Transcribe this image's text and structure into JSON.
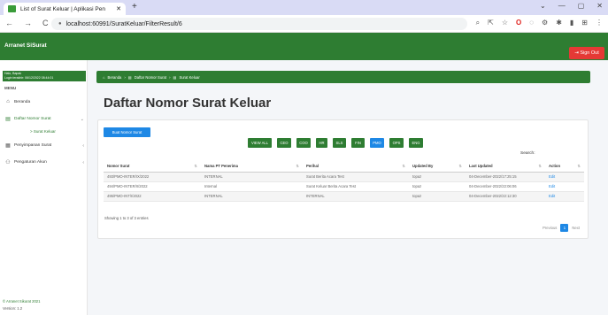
{
  "browser": {
    "tab_title": "List of Surat Keluar | Aplikasi Pen",
    "tab_close": "✕",
    "new_tab": "+",
    "url": "localhost:60991/SuratKeluar/FilterResult/6",
    "win_minimize": "⌄",
    "win_min": "—",
    "win_restore": "▢",
    "win_close": "✕"
  },
  "app": {
    "brand": "Arranet SiSurat",
    "sign_out": "Sign Out"
  },
  "sidebar": {
    "user_line1": "Halo, Bapak",
    "user_line2": "Login terakhir: 06/12/2022 08:44:01",
    "menu_label": "MENU",
    "items": [
      {
        "label": "Beranda",
        "icon": "home-icon"
      },
      {
        "label": "Daftar Nomor Surat",
        "icon": "document-icon"
      },
      {
        "label": "Penyimpanan Surat",
        "icon": "archive-icon"
      },
      {
        "label": "Pengaturan Akun",
        "icon": "users-icon"
      }
    ],
    "sub_item": "> Surat Keluar",
    "footer_copyright": "© Arranet Sikurat 2021",
    "footer_version": "Version: 1.2"
  },
  "breadcrumb": [
    "Beranda",
    "Daftar Nomor Surat",
    "Surat Keluar"
  ],
  "page_title": "Daftar Nomor Surat Keluar",
  "buttons": {
    "buat": "Buat Nomor Surat"
  },
  "filters": [
    "VIEW ALL",
    "CEO",
    "COO",
    "HR",
    "SLS",
    "FIN",
    "PMO",
    "OPS",
    "ENG"
  ],
  "active_filter": "PMO",
  "search_label": "Search:",
  "table": {
    "headers": [
      "Nomor Surat",
      "Nama PT Penerima",
      "Perihal",
      "Updated By",
      "Last Updated",
      "Action"
    ],
    "rows": [
      [
        "493/PMO-INTER/IX/2022",
        "INTERNAL",
        "Surat Berita Acara Test",
        "topaz",
        "04-December-2022/17:25:15",
        "Edit"
      ],
      [
        "494/PMO-INTER/II/2022",
        "Internal",
        "Surat Keluar Berita Acara Test",
        "topaz",
        "04-December-2022/22:06:06",
        "Edit"
      ],
      [
        "495/PMO-INT/I/2022",
        "INTERNAL",
        "INTERNAL",
        "topaz",
        "04-December-2022/22:12:30",
        "Edit"
      ]
    ]
  },
  "table_info": "Showing 1 to 3 of 3 entries",
  "pagination": {
    "previous": "Previous",
    "page": "1",
    "next": "Next"
  }
}
